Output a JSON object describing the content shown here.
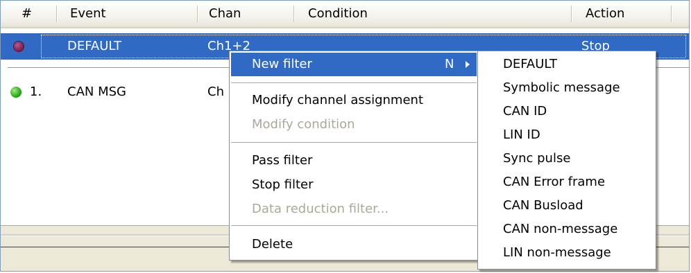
{
  "columns": [
    {
      "key": "num",
      "label": "#"
    },
    {
      "key": "event",
      "label": "Event"
    },
    {
      "key": "chan",
      "label": "Chan"
    },
    {
      "key": "condition",
      "label": "Condition"
    },
    {
      "key": "action",
      "label": "Action"
    }
  ],
  "rows": [
    {
      "status_color": "#7a1e52",
      "num": "",
      "event": "DEFAULT",
      "chan": "Ch1+2",
      "condition": "",
      "action": "Stop",
      "selected": true
    },
    {
      "status_color": "#1c9a12",
      "num": "1.",
      "event": "CAN MSG",
      "chan": "Ch",
      "condition": "",
      "action": "",
      "selected": false
    }
  ],
  "context_menu": {
    "items": [
      {
        "label": "New filter",
        "shortcut": "N",
        "has_submenu": true,
        "highlighted": true,
        "disabled": false
      },
      {
        "label": "Modify channel assignment",
        "disabled": false
      },
      {
        "label": "Modify condition",
        "disabled": true
      },
      {
        "label": "Pass filter",
        "disabled": false
      },
      {
        "label": "Stop filter",
        "disabled": false
      },
      {
        "label": "Data reduction filter...",
        "disabled": true
      },
      {
        "label": "Delete",
        "disabled": false
      }
    ]
  },
  "submenu": {
    "items": [
      "DEFAULT",
      "Symbolic message",
      "CAN ID",
      "LIN ID",
      "Sync pulse",
      "CAN Error frame",
      "CAN Busload",
      "CAN non-message",
      "LIN non-message"
    ]
  },
  "colors": {
    "selection": "#316ac5",
    "menu_border": "#8a8a8a"
  }
}
